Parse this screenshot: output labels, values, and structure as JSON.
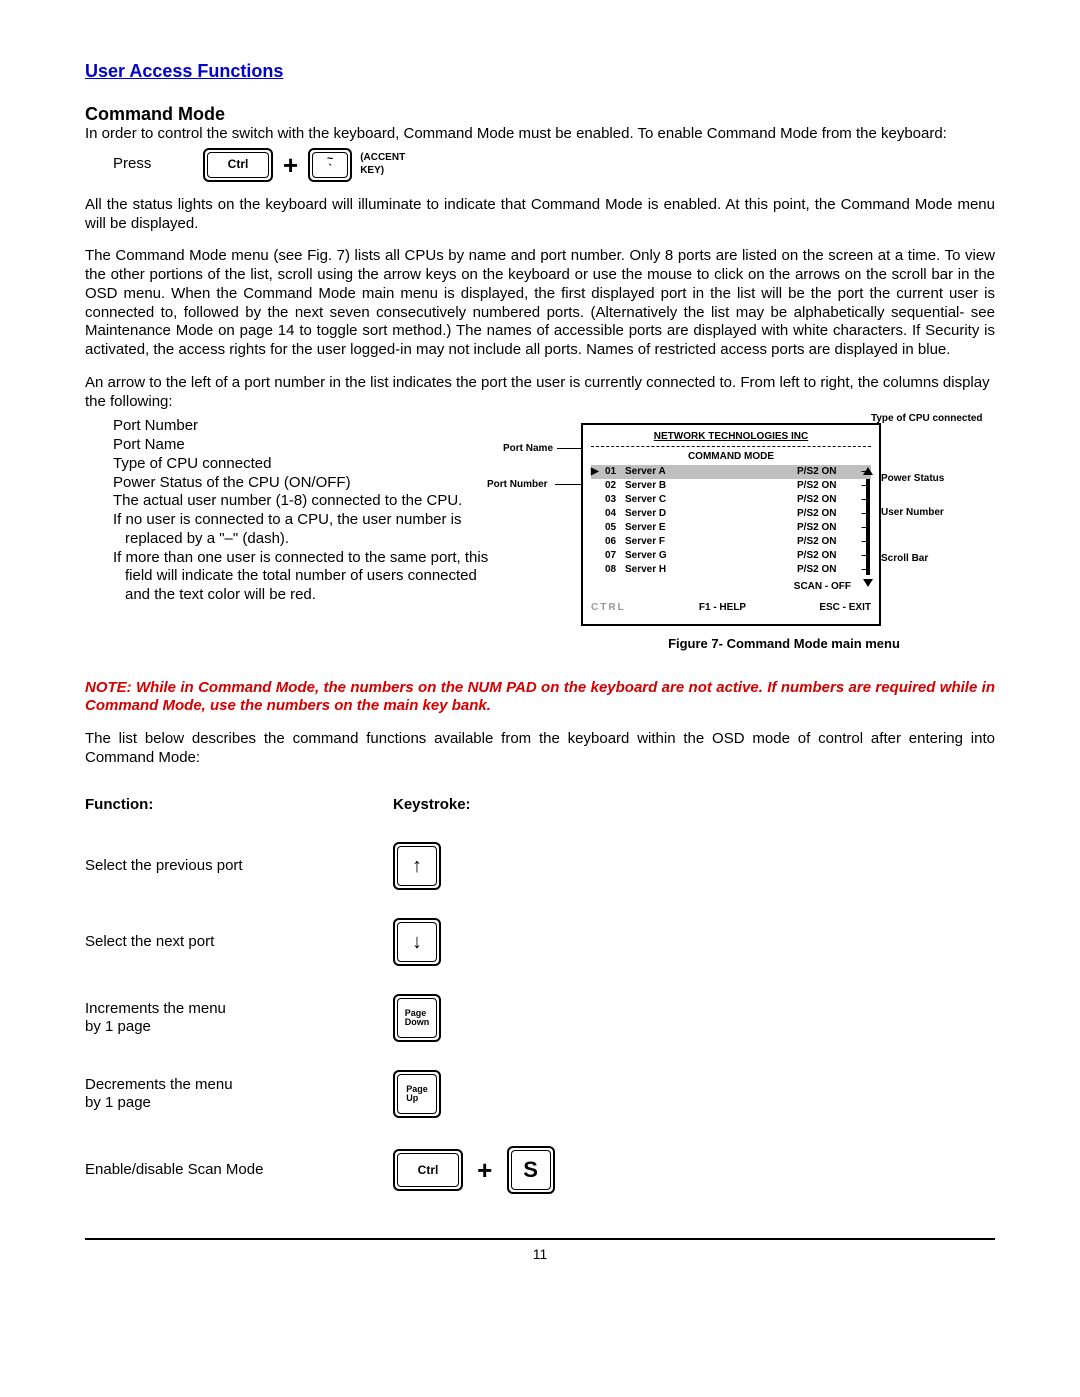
{
  "section_title": "User Access Functions",
  "command_mode_heading": "Command Mode",
  "intro": "In order to control the switch with the keyboard, Command Mode must be enabled.  To enable Command Mode from the keyboard:",
  "press_label": "Press",
  "keys": {
    "ctrl": "Ctrl",
    "tilde_top": "~",
    "tilde_bot": "`",
    "accent_label": "(ACCENT KEY)",
    "page_down": "Page\nDown",
    "page_up": "Page\nUp",
    "s_key": "S",
    "up_arrow": "↑",
    "down_arrow": "↓"
  },
  "para2": "All the status lights on the keyboard will illuminate to indicate that Command Mode is enabled.  At this point, the Command Mode menu will be displayed.",
  "para3": "The Command Mode menu (see Fig. 7) lists all CPUs by name and port number.  Only 8 ports are listed on the screen at a time. To view the other portions of the list, scroll using the arrow keys on the keyboard or use the mouse to click on the arrows on the scroll bar in the OSD menu.   When the Command Mode main menu is displayed, the first displayed port in the list will be the port the current user is connected to, followed by the next seven consecutively numbered ports.  (Alternatively the list may be alphabetically sequential- see Maintenance Mode on page 14 to toggle sort method.)    The names of accessible ports are displayed with white characters. If Security is activated, the access rights for the user logged-in may not include all ports. Names of restricted access ports are displayed in blue.",
  "para4": "An arrow to the left of a port number in the list indicates the port the user is currently connected to. From left to right, the columns display the following:",
  "bullets": {
    "b1": "Port Number",
    "b2": "Port Name",
    "b3": "Type of CPU connected",
    "b4": "Power Status of the CPU (ON/OFF)",
    "b5": "The actual user number (1-8) connected to the CPU.",
    "b6": "If no user is connected to a CPU, the user number is",
    "b6b": "replaced by a \"–\" (dash).",
    "b7": "If more than one user is connected to the same port, this",
    "b7b": "field will indicate the total number of users connected and the text color will be red."
  },
  "osd": {
    "company": "NETWORK TECHNOLOGIES INC",
    "title": "COMMAND MODE",
    "rows": [
      {
        "num": "01",
        "name": "Server A",
        "status": "P/S2 ON",
        "dash": "–",
        "sel": true
      },
      {
        "num": "02",
        "name": "Server B",
        "status": "P/S2 ON",
        "dash": "–",
        "sel": false
      },
      {
        "num": "03",
        "name": "Server C",
        "status": "P/S2 ON",
        "dash": "–",
        "sel": false
      },
      {
        "num": "04",
        "name": "Server D",
        "status": "P/S2 ON",
        "dash": "–",
        "sel": false
      },
      {
        "num": "05",
        "name": "Server E",
        "status": "P/S2 ON",
        "dash": "–",
        "sel": false
      },
      {
        "num": "06",
        "name": "Server F",
        "status": "P/S2 ON",
        "dash": "–",
        "sel": false
      },
      {
        "num": "07",
        "name": "Server G",
        "status": "P/S2 ON",
        "dash": "–",
        "sel": false
      },
      {
        "num": "08",
        "name": "Server H",
        "status": "P/S2 ON",
        "dash": "–",
        "sel": false
      }
    ],
    "scan": "SCAN  -  OFF",
    "foot_ctrl": "CTRL",
    "foot_help": "F1 - HELP",
    "foot_exit": "ESC  -  EXIT"
  },
  "callouts": {
    "type_cpu": "Type of CPU connected",
    "port_name": "Port Name",
    "port_number": "Port Number",
    "power_status": "Power Status",
    "user_number": "User Number",
    "scroll_bar": "Scroll Bar"
  },
  "figure_caption": "Figure 7- Command Mode main menu",
  "note": "NOTE: While in Command Mode, the numbers on the NUM PAD on the keyboard are not active. If numbers are required while in Command Mode, use the numbers on the main key bank.",
  "list_intro": "The list below describes the command functions available from the keyboard within the OSD mode of control after entering into Command Mode:",
  "headers": {
    "func": "Function:",
    "keystroke": "Keystroke:"
  },
  "functions": {
    "f1": "Select the previous port",
    "f2": "Select the next port",
    "f3a": "Increments the menu",
    "f3b": "by 1 page",
    "f4a": "Decrements the menu",
    "f4b": "by 1 page",
    "f5": "Enable/disable Scan Mode"
  },
  "page_number": "11"
}
